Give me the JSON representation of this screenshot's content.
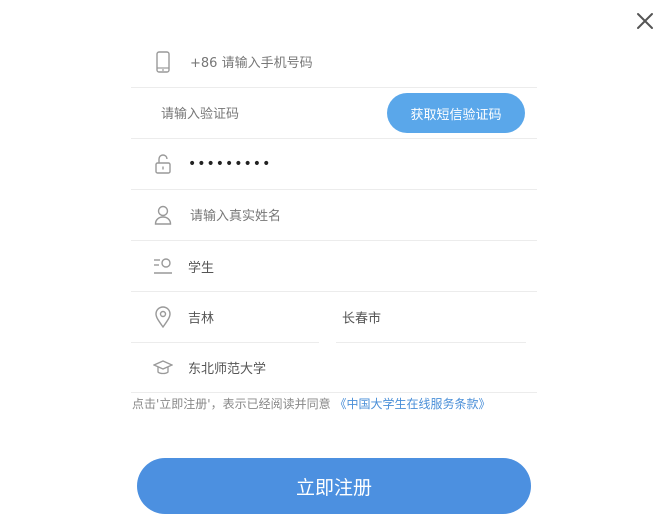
{
  "dialog": {
    "close_icon": "close-icon"
  },
  "form": {
    "phone": {
      "placeholder": "+86 请输入手机号码",
      "icon": "mobile-phone-icon"
    },
    "code": {
      "placeholder": "请输入验证码",
      "button_label": "获取短信验证码"
    },
    "password": {
      "value": "•••••••••",
      "icon": "unlock-icon"
    },
    "real_name": {
      "placeholder": "请输入真实姓名",
      "icon": "user-icon"
    },
    "identity": {
      "value": "学生",
      "icon": "user-role-icon"
    },
    "province": {
      "value": "吉林",
      "icon": "location-pin-icon"
    },
    "city": {
      "value": "长春市"
    },
    "school": {
      "value": "东北师范大学",
      "icon": "graduation-cap-icon"
    }
  },
  "agreement": {
    "text": "点击'立即注册'，表示已经阅读并同意",
    "link": "《中国大学生在线服务条款》"
  },
  "submit_label": "立即注册",
  "colors": {
    "accent": "#4c90e0",
    "sms_button": "#5aa7ea",
    "link": "#4a8fd8"
  }
}
